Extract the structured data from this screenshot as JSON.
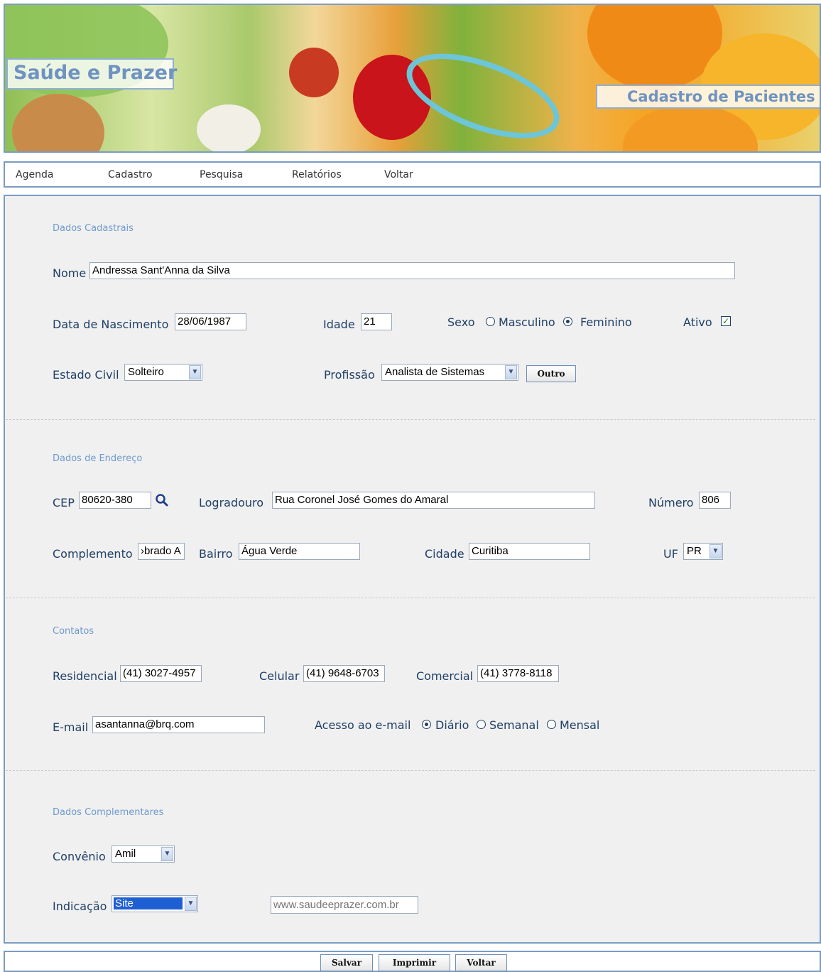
{
  "header": {
    "brand": "Saúde e Prazer",
    "page_title": "Cadastro de Pacientes"
  },
  "menu": {
    "items": [
      "Agenda",
      "Cadastro",
      "Pesquisa",
      "Relatórios",
      "Voltar"
    ]
  },
  "personal": {
    "section_title": "Dados Cadastrais",
    "name_label": "Nome",
    "name_value": "Andressa Sant'Anna da Silva",
    "birth_label": "Data de Nascimento",
    "birth_value": "28/06/1987",
    "age_label": "Idade",
    "age_value": "21",
    "sex_label": "Sexo",
    "sex_options": [
      "Masculino",
      "Feminino"
    ],
    "sex_selected": "Feminino",
    "active_label": "Ativo",
    "active_checked": true,
    "civil_label": "Estado Civil",
    "civil_value": "Solteiro",
    "profession_label": "Profissão",
    "profession_value": "Analista de Sistemas",
    "other_button": "Outro"
  },
  "address": {
    "section_title": "Dados de Endereço",
    "cep_label": "CEP",
    "cep_value": "80620-380",
    "street_label": "Logradouro",
    "street_value": "Rua Coronel José Gomes do Amaral",
    "number_label": "Número",
    "number_value": "806",
    "complement_label": "Complemento",
    "complement_value": "›brado A",
    "district_label": "Bairro",
    "district_value": "Água Verde",
    "city_label": "Cidade",
    "city_value": "Curitiba",
    "uf_label": "UF",
    "uf_value": "PR"
  },
  "contacts": {
    "section_title": "Contatos",
    "home_label": "Residencial",
    "home_value": "(41) 3027-4957",
    "mobile_label": "Celular",
    "mobile_value": "(41) 9648-6703",
    "work_label": "Comercial",
    "work_value": "(41) 3778-8118",
    "email_label": "E-mail",
    "email_value": "asantanna@brq.com",
    "access_label": "Acesso ao e-mail",
    "access_options": [
      "Diário",
      "Semanal",
      "Mensal"
    ],
    "access_selected": "Diário"
  },
  "extra": {
    "section_title": "Dados Complementares",
    "insurance_label": "Convênio",
    "insurance_value": "Amil",
    "referral_label": "Indicação",
    "referral_value": "Site",
    "site_placeholder": "www.saudeeprazer.com.br"
  },
  "footer": {
    "save": "Salvar",
    "print": "Imprimir",
    "back": "Voltar"
  },
  "colors": {
    "label_text": "#1f3f66",
    "section_title": "#6f9ad0",
    "frame_border": "#7a9cc3",
    "panel_bg": "#f0f0f0",
    "selected_highlight": "#1f5fd4"
  }
}
